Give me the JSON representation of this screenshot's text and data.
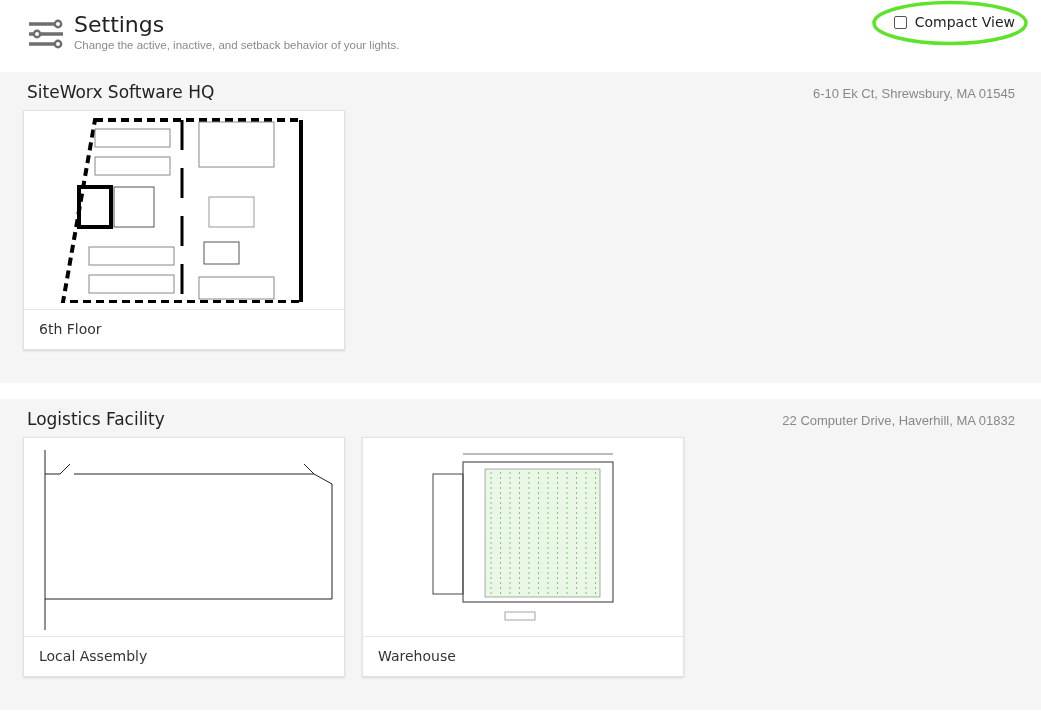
{
  "header": {
    "title": "Settings",
    "subtitle": "Change the active, inactive, and setback behavior of your lights."
  },
  "compact_view": {
    "label": "Compact View",
    "checked": false
  },
  "sites": [
    {
      "name": "SiteWorx Software HQ",
      "address": "6-10 Ek Ct, Shrewsbury, MA 01545",
      "floors": [
        {
          "name": "6th Floor"
        }
      ]
    },
    {
      "name": "Logistics Facility",
      "address": "22 Computer Drive, Haverhill, MA 01832",
      "floors": [
        {
          "name": "Local Assembly"
        },
        {
          "name": "Warehouse"
        }
      ]
    }
  ]
}
